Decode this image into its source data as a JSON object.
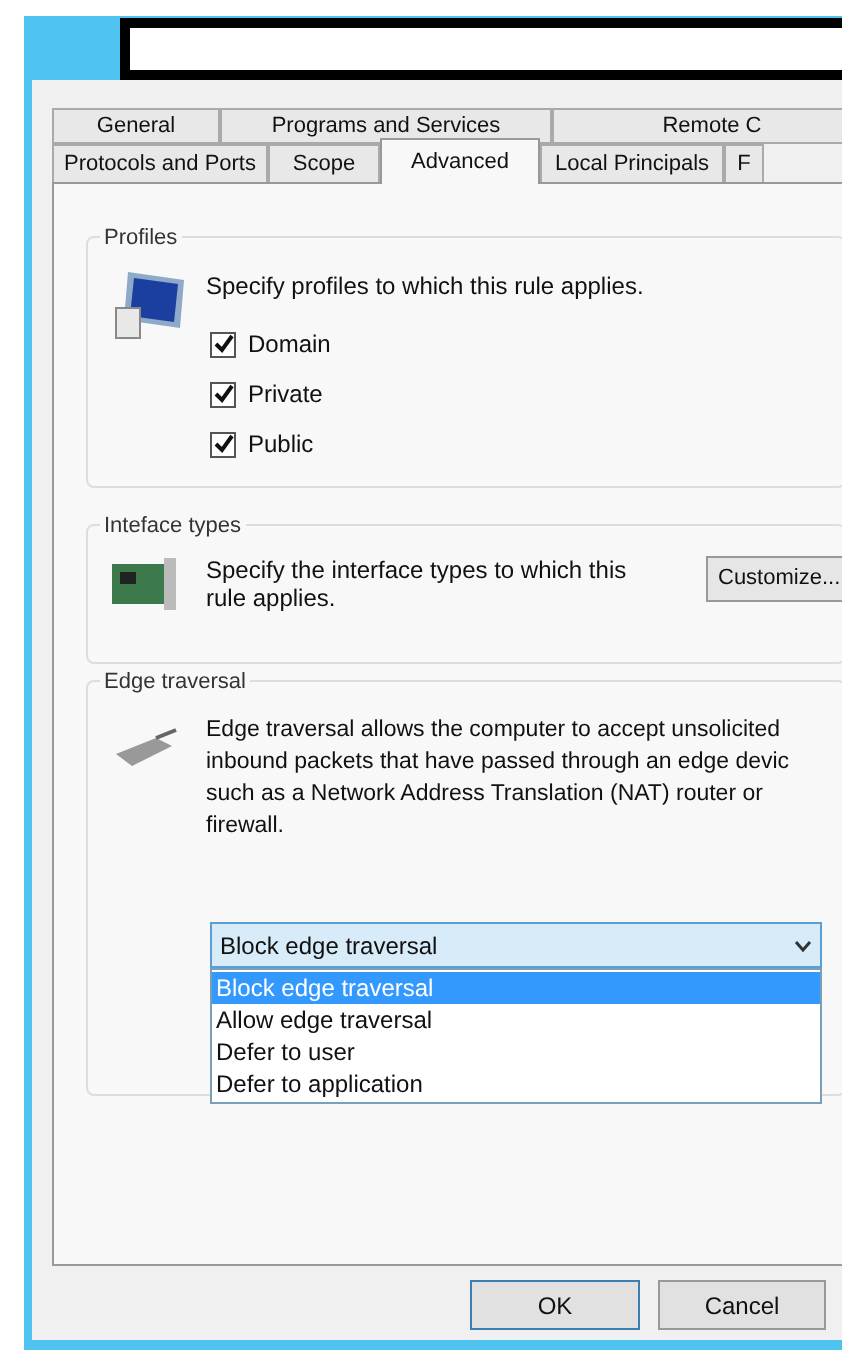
{
  "tabs_row_1": [
    {
      "label": "General",
      "selected": false
    },
    {
      "label": "Programs and Services",
      "selected": false
    },
    {
      "label": "Remote C",
      "selected": false
    }
  ],
  "tabs_row_2": [
    {
      "label": "Protocols and Ports",
      "selected": false
    },
    {
      "label": "Scope",
      "selected": false
    },
    {
      "label": "Advanced",
      "selected": true
    },
    {
      "label": "Local Principals",
      "selected": false
    },
    {
      "label": "F",
      "selected": false
    }
  ],
  "profiles": {
    "title": "Profiles",
    "description": "Specify profiles to which this rule applies.",
    "options": [
      {
        "label": "Domain",
        "checked": true
      },
      {
        "label": "Private",
        "checked": true
      },
      {
        "label": "Public",
        "checked": true
      }
    ]
  },
  "interface_types": {
    "title": "Inteface types",
    "description": "Specify the interface types to which this\nrule applies.",
    "button": "Customize..."
  },
  "edge_traversal": {
    "title": "Edge traversal",
    "description": "Edge traversal allows the computer to accept unsolicited\ninbound packets that have passed through an edge devic\nsuch as a Network Address Translation (NAT) router or\nfirewall.",
    "dropdown": {
      "value": "Block edge traversal",
      "expanded": true,
      "options": [
        {
          "label": "Block edge traversal",
          "selected": true
        },
        {
          "label": "Allow edge traversal",
          "selected": false
        },
        {
          "label": "Defer to user",
          "selected": false
        },
        {
          "label": "Defer to application",
          "selected": false
        }
      ]
    }
  },
  "buttons": [
    "OK",
    "Cancel"
  ]
}
